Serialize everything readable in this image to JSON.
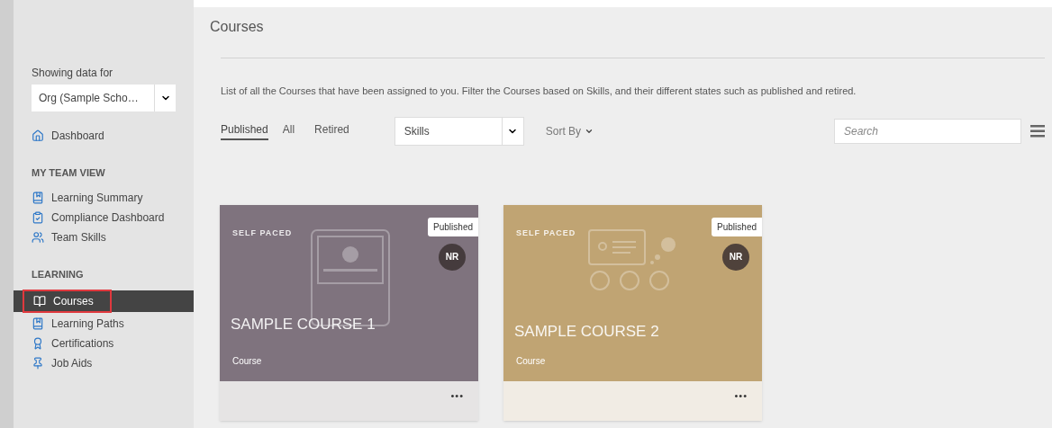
{
  "sidebar": {
    "org_label": "Showing data for",
    "org_select": "Org (Sample Scho…",
    "items": [
      {
        "kind": "link",
        "label": "Dashboard",
        "selected": false
      },
      {
        "kind": "heading",
        "label": "MY TEAM VIEW"
      },
      {
        "kind": "link",
        "label": "Learning Summary",
        "selected": false
      },
      {
        "kind": "link",
        "label": "Compliance Dashboard",
        "selected": false
      },
      {
        "kind": "link",
        "label": "Team Skills",
        "selected": false
      },
      {
        "kind": "heading",
        "label": "LEARNING"
      },
      {
        "kind": "link",
        "label": "Courses",
        "selected": true
      },
      {
        "kind": "link",
        "label": "Learning Paths",
        "selected": false
      },
      {
        "kind": "link",
        "label": "Certifications",
        "selected": false
      },
      {
        "kind": "link",
        "label": "Job Aids",
        "selected": false
      }
    ]
  },
  "page": {
    "title": "Courses",
    "description": "List of all the Courses that have been assigned to you. Filter the Courses based on Skills, and their different states such as published and retired.",
    "tabs": [
      {
        "label": "Published",
        "selected": true
      },
      {
        "label": "All",
        "selected": false
      },
      {
        "label": "Retired",
        "selected": false
      }
    ],
    "skills_select": "Skills",
    "sort_by": "Sort By",
    "search": {
      "placeholder": "Search"
    }
  },
  "cards": [
    {
      "type_label": "SELF PACED",
      "status": "Published",
      "avatar": "NR",
      "title": "SAMPLE COURSE 1",
      "category": "Course",
      "kind": "video",
      "color": "#7f737e",
      "menu": "•••"
    },
    {
      "type_label": "SELF PACED",
      "status": "Published",
      "avatar": "NR",
      "title": "SAMPLE COURSE 2",
      "category": "Course",
      "kind": "classroom",
      "color": "#c0a473",
      "menu": "•••"
    }
  ]
}
